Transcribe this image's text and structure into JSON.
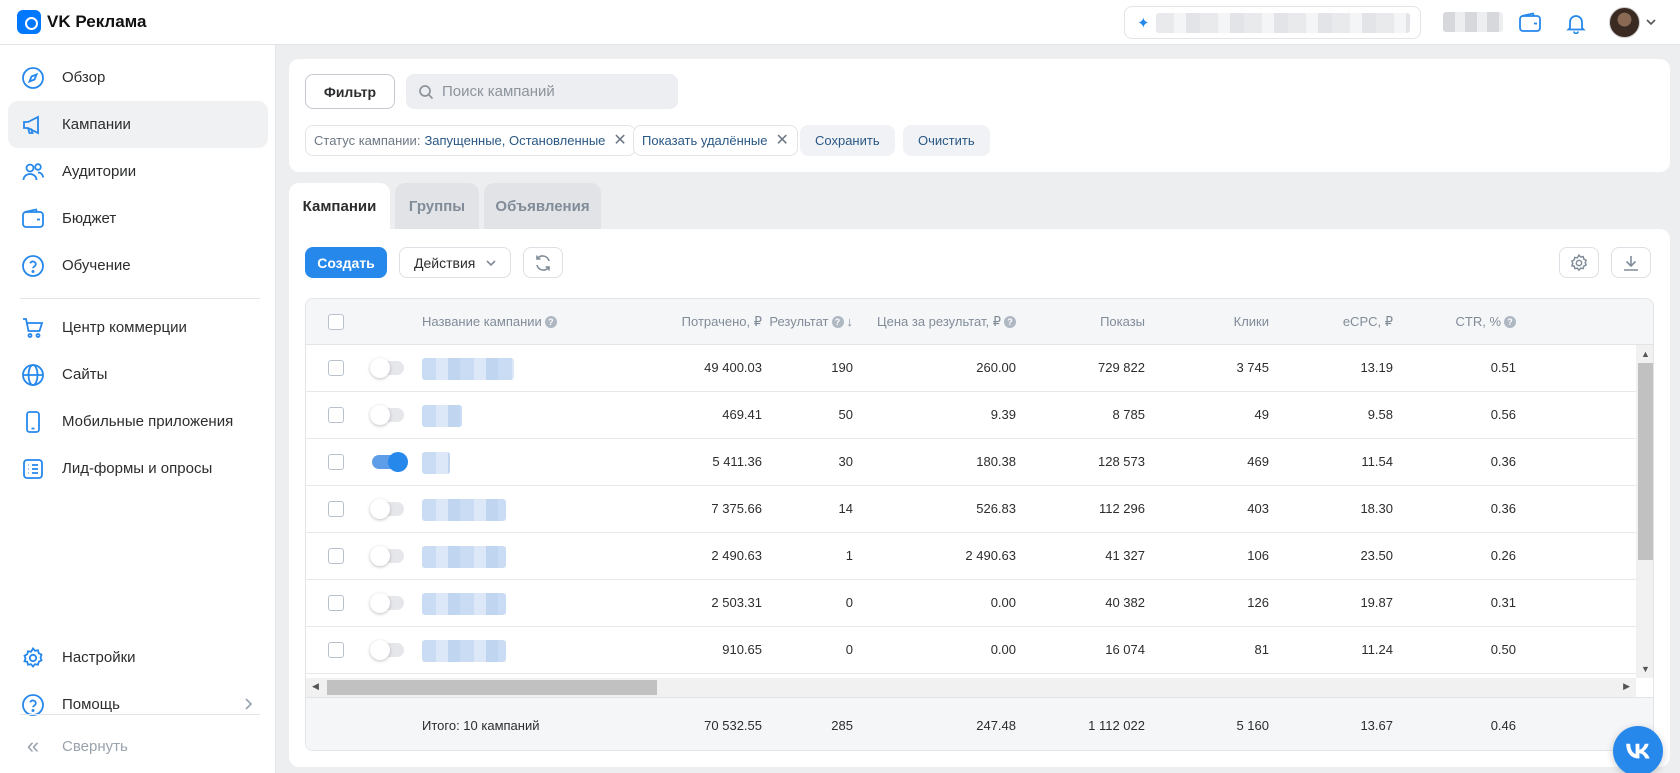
{
  "app": {
    "title": "VK Реклама"
  },
  "sidebar": {
    "items": [
      {
        "label": "Обзор"
      },
      {
        "label": "Кампании"
      },
      {
        "label": "Аудитории"
      },
      {
        "label": "Бюджет"
      },
      {
        "label": "Обучение"
      },
      {
        "label": "Центр коммерции"
      },
      {
        "label": "Сайты"
      },
      {
        "label": "Мобильные приложения"
      },
      {
        "label": "Лид-формы и опросы"
      },
      {
        "label": "Настройки"
      },
      {
        "label": "Помощь"
      }
    ],
    "collapse_label": "Свернуть"
  },
  "filter": {
    "button_label": "Фильтр",
    "search_placeholder": "Поиск кампаний",
    "chips": [
      {
        "key": "Статус кампании:",
        "value": "Запущенные, Остановленные"
      },
      {
        "key": "",
        "value": "Показать удалённые"
      }
    ],
    "save_label": "Сохранить",
    "clear_label": "Очистить"
  },
  "tabs": [
    {
      "label": "Кампании",
      "active": true
    },
    {
      "label": "Группы",
      "active": false
    },
    {
      "label": "Объявления",
      "active": false
    }
  ],
  "toolbar": {
    "create_label": "Создать",
    "actions_label": "Действия"
  },
  "table": {
    "columns": [
      "Название кампании",
      "Потрачено, ₽",
      "Результат",
      "Цена за результат, ₽",
      "Показы",
      "Клики",
      "eCPC, ₽",
      "CTR, %"
    ],
    "rows": [
      {
        "enabled": false,
        "spent": "49 400.03",
        "result": "190",
        "cost": "260.00",
        "impressions": "729 822",
        "clicks": "3 745",
        "ecpc": "13.19",
        "ctr": "0.51"
      },
      {
        "enabled": false,
        "spent": "469.41",
        "result": "50",
        "cost": "9.39",
        "impressions": "8 785",
        "clicks": "49",
        "ecpc": "9.58",
        "ctr": "0.56"
      },
      {
        "enabled": true,
        "spent": "5 411.36",
        "result": "30",
        "cost": "180.38",
        "impressions": "128 573",
        "clicks": "469",
        "ecpc": "11.54",
        "ctr": "0.36"
      },
      {
        "enabled": false,
        "spent": "7 375.66",
        "result": "14",
        "cost": "526.83",
        "impressions": "112 296",
        "clicks": "403",
        "ecpc": "18.30",
        "ctr": "0.36"
      },
      {
        "enabled": false,
        "spent": "2 490.63",
        "result": "1",
        "cost": "2 490.63",
        "impressions": "41 327",
        "clicks": "106",
        "ecpc": "23.50",
        "ctr": "0.26"
      },
      {
        "enabled": false,
        "spent": "2 503.31",
        "result": "0",
        "cost": "0.00",
        "impressions": "40 382",
        "clicks": "126",
        "ecpc": "19.87",
        "ctr": "0.31"
      },
      {
        "enabled": false,
        "spent": "910.65",
        "result": "0",
        "cost": "0.00",
        "impressions": "16 074",
        "clicks": "81",
        "ecpc": "11.24",
        "ctr": "0.50"
      }
    ],
    "total": {
      "label": "Итого: 10 кампаний",
      "spent": "70 532.55",
      "result": "285",
      "cost": "247.48",
      "impressions": "1 112 022",
      "clicks": "5 160",
      "ecpc": "13.67",
      "ctr": "0.46"
    }
  },
  "colors": {
    "accent": "#2688eb",
    "link": "#2a5885",
    "muted": "#818c99"
  }
}
